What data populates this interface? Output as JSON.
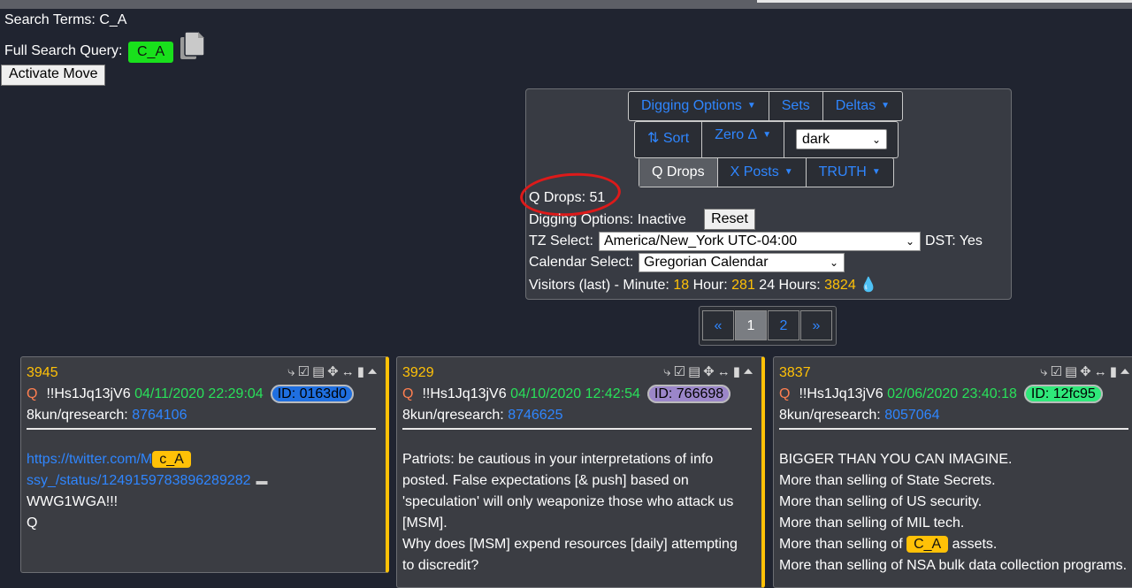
{
  "header": {
    "search_terms_label": "Search Terms:",
    "search_terms_value": "C_A",
    "full_query_label": "Full Search Query:",
    "full_query_value": "C_A",
    "activate_button": "Activate Move"
  },
  "panel": {
    "row1": {
      "digging_options": "Digging Options",
      "sets": "Sets",
      "deltas": "Deltas"
    },
    "row2": {
      "sort": "Sort",
      "zero_delta": "Zero Δ",
      "theme_select": "dark"
    },
    "row3": {
      "q_drops": "Q Drops",
      "x_posts": "X Posts",
      "truth": "TRUTH"
    },
    "q_drops_count": "Q Drops: 51",
    "digging_options_status": "Digging Options: Inactive",
    "reset_button": "Reset",
    "tz_label": "TZ Select:",
    "tz_value": "America/New_York UTC-04:00",
    "dst_text": "DST: Yes",
    "calendar_label": "Calendar Select:",
    "calendar_value": "Gregorian Calendar",
    "visitors": {
      "label_minute": "Visitors (last) - Minute:",
      "minute": "18",
      "label_hour": "Hour:",
      "hour": "281",
      "label_24h": "24 Hours:",
      "day": "3824"
    }
  },
  "pagination": {
    "prev": "«",
    "pages": [
      "1",
      "2"
    ],
    "next": "»",
    "current": "1"
  },
  "cards": [
    {
      "number": "3945",
      "author": "Q",
      "tripcode": "!!Hs1Jq13jV6",
      "date": "04/11/2020 22:29:04",
      "id": "ID: 0163d0",
      "id_color": "#1f6fe0",
      "board": "8kun/qresearch:",
      "post": "8764106",
      "link_part1": "https://twitter.com/M",
      "highlight": "c_A",
      "link_part2": "ssy_/status/1249159783896289282",
      "lines": [
        "WWG1WGA!!!",
        "Q"
      ]
    },
    {
      "number": "3929",
      "author": "Q",
      "tripcode": "!!Hs1Jq13jV6",
      "date": "04/10/2020 12:42:54",
      "id": "ID: 766698",
      "id_color": "#9b86c9",
      "board": "8kun/qresearch:",
      "post": "8746625",
      "lines": [
        "Patriots: be cautious in your interpretations of info",
        "posted. False expectations [& push] based on",
        "'speculation' will only weaponize those who attack us",
        "[MSM].",
        "Why does [MSM] expend resources [daily] attempting",
        "to discredit?"
      ]
    },
    {
      "number": "3837",
      "author": "Q",
      "tripcode": "!!Hs1Jq13jV6",
      "date": "02/06/2020 23:40:18",
      "id": "ID: 12fc95",
      "id_color": "#2fe87a",
      "board": "8kun/qresearch:",
      "post": "8057064",
      "lines": [
        "BIGGER THAN YOU CAN IMAGINE.",
        "More than selling of State Secrets.",
        "More than selling of US security.",
        "More than selling of MIL tech."
      ],
      "highlight_pre": "More than selling of",
      "highlight": "C_A",
      "highlight_post": "assets.",
      "last_line": "More than selling of NSA bulk data collection programs."
    }
  ]
}
